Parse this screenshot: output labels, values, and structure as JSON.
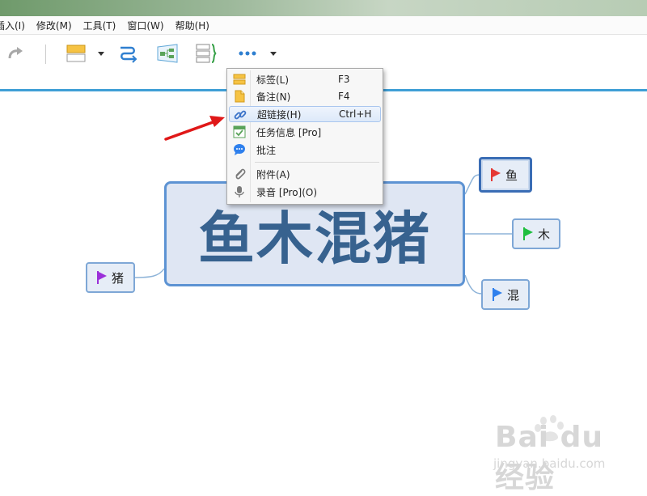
{
  "menubar": {
    "items": [
      "插入(I)",
      "修改(M)",
      "工具(T)",
      "窗口(W)",
      "帮助(H)"
    ]
  },
  "toolbar": {
    "icons": [
      "redo-icon",
      "topic-style-icon",
      "relationship-icon",
      "summary-structure-icon",
      "boundary-icon",
      "more-icon"
    ]
  },
  "mindmap": {
    "central": "鱼木混猪",
    "subtopics": [
      {
        "label": "鱼",
        "flag_color": "#e53935"
      },
      {
        "label": "木",
        "flag_color": "#1fbf3f"
      },
      {
        "label": "混",
        "flag_color": "#2f80ed"
      },
      {
        "label": "猪",
        "flag_color": "#9b30d9"
      }
    ]
  },
  "context_menu": {
    "items": [
      {
        "label": "标签(L)",
        "shortcut": "F3",
        "icon": "label-icon"
      },
      {
        "label": "备注(N)",
        "shortcut": "F4",
        "icon": "note-icon"
      },
      {
        "label": "超链接(H)",
        "shortcut": "Ctrl+H",
        "icon": "hyperlink-icon",
        "highlighted": true
      },
      {
        "label": "任务信息 [Pro]",
        "shortcut": "",
        "icon": "task-info-icon"
      },
      {
        "label": "批注",
        "shortcut": "",
        "icon": "comment-icon"
      },
      {
        "label": "附件(A)",
        "shortcut": "",
        "icon": "attachment-icon"
      },
      {
        "label": "录音 [Pro](O)",
        "shortcut": "",
        "icon": "microphone-icon"
      }
    ]
  },
  "watermark": {
    "brand": "Bai du 经验",
    "site": "jingyan.baidu.com"
  },
  "colors": {
    "accent": "#3f9fd6",
    "topic_border": "#5d93d3",
    "topic_text": "#37628f"
  }
}
